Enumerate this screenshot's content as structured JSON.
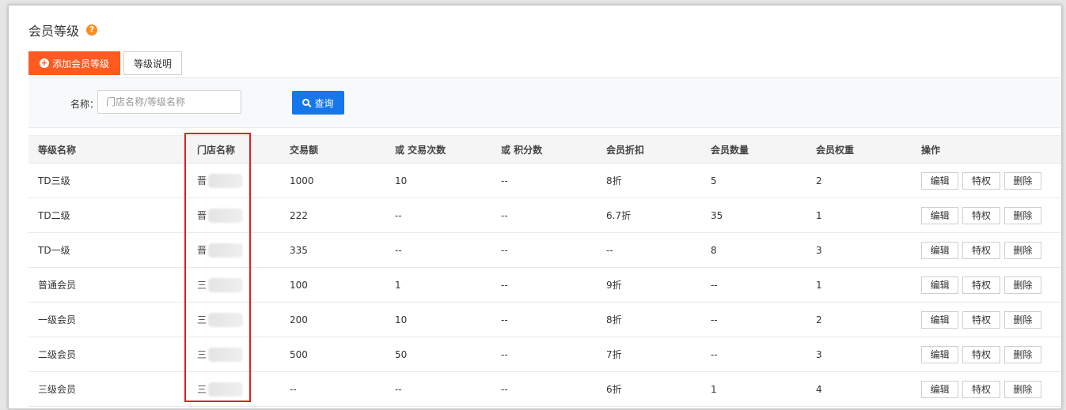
{
  "page": {
    "title": "会员等级",
    "help_icon": "question-circle-icon"
  },
  "toolbar": {
    "add_label": "添加会员等级",
    "desc_label": "等级说明"
  },
  "filter": {
    "name_label": "名称：",
    "name_placeholder": "门店名称/等级名称",
    "query_label": "查询"
  },
  "table": {
    "headers": [
      "等级名称",
      "门店名称",
      "交易额",
      "或 交易次数",
      "或 积分数",
      "会员折扣",
      "会员数量",
      "会员权重",
      "操作"
    ],
    "actions": [
      "编辑",
      "特权",
      "删除"
    ],
    "rows": [
      {
        "name": "TD三级",
        "store": "晋",
        "amount": "1000",
        "count": "10",
        "points": "--",
        "discount": "8折",
        "members": "5",
        "weight": "2"
      },
      {
        "name": "TD二级",
        "store": "晋",
        "amount": "222",
        "count": "--",
        "points": "--",
        "discount": "6.7折",
        "members": "35",
        "weight": "1"
      },
      {
        "name": "TD一级",
        "store": "晋",
        "amount": "335",
        "count": "--",
        "points": "--",
        "discount": "--",
        "members": "8",
        "weight": "3"
      },
      {
        "name": "普通会员",
        "store": "三",
        "amount": "100",
        "count": "1",
        "points": "--",
        "discount": "9折",
        "members": "--",
        "weight": "1"
      },
      {
        "name": "一级会员",
        "store": "三",
        "amount": "200",
        "count": "10",
        "points": "--",
        "discount": "8折",
        "members": "--",
        "weight": "2"
      },
      {
        "name": "二级会员",
        "store": "三",
        "amount": "500",
        "count": "50",
        "points": "--",
        "discount": "7折",
        "members": "--",
        "weight": "3"
      },
      {
        "name": "三级会员",
        "store": "三",
        "amount": "--",
        "count": "--",
        "points": "--",
        "discount": "6折",
        "members": "1",
        "weight": "4"
      }
    ]
  },
  "colors": {
    "primary_orange": "#ff5a1f",
    "query_blue": "#1677ea",
    "highlight_red": "#e02020"
  }
}
